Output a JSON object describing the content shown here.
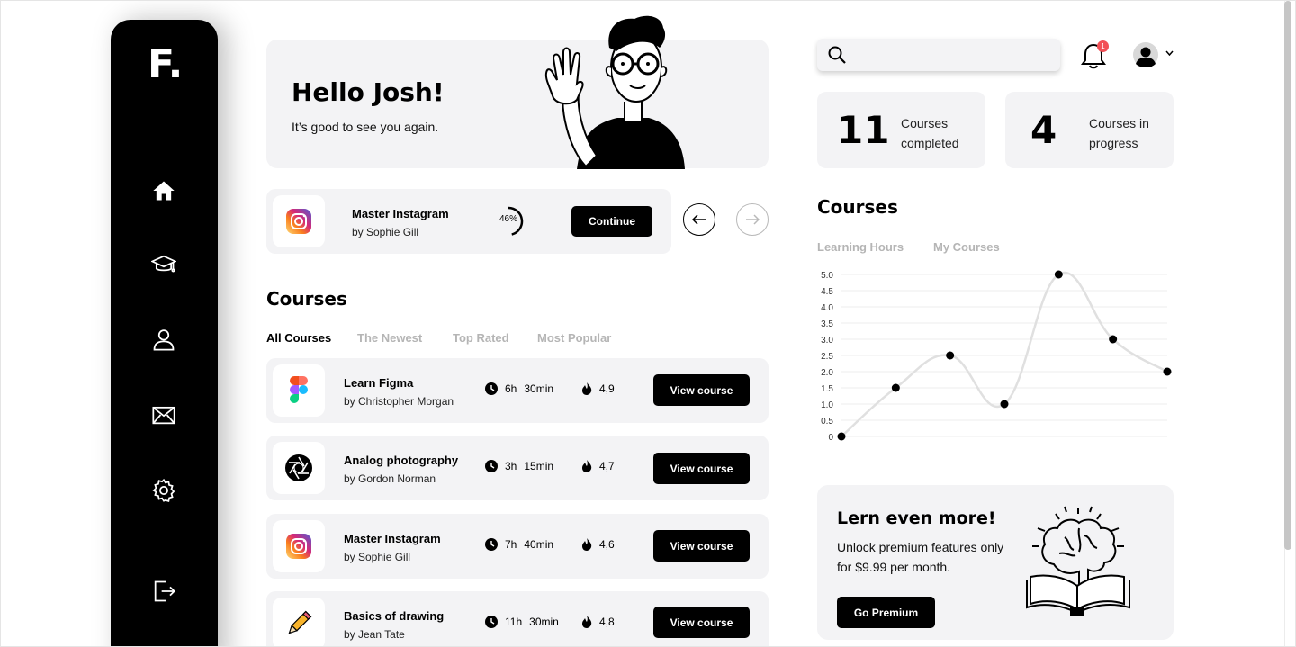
{
  "brand": {
    "logo": "F."
  },
  "hero": {
    "title": "Hello Josh!",
    "subtitle": "It’s good to see you again."
  },
  "continue": {
    "course": "Master Instagram",
    "author": "by Sophie Gill",
    "progress_label": "46%",
    "progress": 0.46,
    "button": "Continue"
  },
  "courses_section": {
    "title": "Courses",
    "tabs": [
      "All Courses",
      "The Newest",
      "Top Rated",
      "Most Popular"
    ],
    "active_tab": "All Courses",
    "rows": [
      {
        "icon": "figma-icon",
        "title": "Learn Figma",
        "author": "by Christopher Morgan",
        "hours": "6h",
        "minutes": "30min",
        "rating": "4,9",
        "button": "View course"
      },
      {
        "icon": "aperture-icon",
        "title": "Analog photography",
        "author": "by Gordon Norman",
        "hours": "3h",
        "minutes": "15min",
        "rating": "4,7",
        "button": "View course"
      },
      {
        "icon": "instagram-icon",
        "title": "Master Instagram",
        "author": "by Sophie Gill",
        "hours": "7h",
        "minutes": "40min",
        "rating": "4,6",
        "button": "View course"
      },
      {
        "icon": "pencil-icon",
        "title": "Basics of drawing",
        "author": "by Jean Tate",
        "hours": "11h",
        "minutes": "30min",
        "rating": "4,8",
        "button": "View course"
      }
    ]
  },
  "header": {
    "search": {
      "placeholder": "",
      "value": ""
    },
    "notifications_count": "1"
  },
  "stats": [
    {
      "value": "11",
      "label": "Courses completed"
    },
    {
      "value": "4",
      "label": "Courses in progress"
    }
  ],
  "chart_section": {
    "title": "Courses",
    "tabs": [
      "Learning Hours",
      "My Courses"
    ]
  },
  "chart_data": {
    "type": "line",
    "title": "",
    "xlabel": "",
    "ylabel": "",
    "x": [
      1,
      2,
      3,
      4,
      5,
      6,
      7
    ],
    "series": [
      {
        "values": [
          0,
          1.5,
          2.5,
          1.0,
          5.0,
          3.0,
          2.0
        ]
      }
    ],
    "ylim": [
      0,
      5
    ],
    "yticks": [
      "0",
      "0.5",
      "1.0",
      "1.5",
      "2.0",
      "2.5",
      "3.0",
      "3.5",
      "4.0",
      "4.5",
      "5.0"
    ],
    "grid": true,
    "line_color": "#e0e0e0",
    "point_color": "#000000"
  },
  "premium": {
    "title": "Lern even more!",
    "text": "Unlock premium features only for $9.99 per month.",
    "button": "Go Premium"
  },
  "colors": {
    "accent": "#000000",
    "card_bg": "#f3f3f5",
    "badge": "#f25056"
  }
}
